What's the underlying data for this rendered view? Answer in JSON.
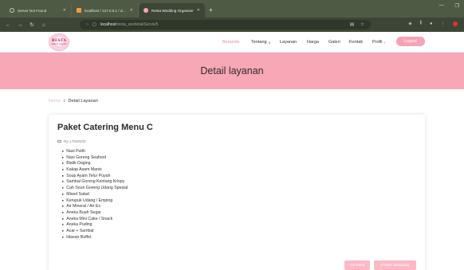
{
  "browser": {
    "tabs": [
      {
        "title": "Server Not Found",
        "active": false
      },
      {
        "title": "localhost / 127.0.0.1 / db_wo / ...",
        "active": false
      },
      {
        "title": "Resta Wedding Organizer",
        "active": true
      }
    ],
    "new_tab": "+",
    "url_host": "localhost",
    "url_path": "/resta_wo/detailServis/5"
  },
  "site": {
    "logo_text": "RESTA",
    "logo_sub": "wedding organizer",
    "nav": [
      "Beranda",
      "Tentang",
      "Layanan",
      "Harga",
      "Galeri",
      "Kontak",
      "Profil"
    ],
    "logout_label": "Logout"
  },
  "banner": {
    "title": "Detail layanan"
  },
  "breadcrumb": {
    "home": "Home",
    "separator": "/",
    "current": "Detail Layanan"
  },
  "package": {
    "title": "Paket Catering Menu C",
    "price": "Rp 17500000",
    "items": [
      "Nasi Putih",
      "Nasi Goreng Seafood",
      "Bistik Daging",
      "Kakap Asam Manis",
      "Soup Ayam Telur Puyuh",
      "Sambal Goreng Kentang Krispy",
      "Cah Soun Goreng Udang Spesial",
      "Mixed Salad",
      "Kerupuk Udang / Emping",
      "Air Mineral / Air Es",
      "Aneka Buah Segar",
      "Aneka Mini Cake / Snack",
      "Aneka Puding",
      "Acar + Sambal",
      "Hiasan Buffet"
    ]
  },
  "actions": {
    "back_label": "Go Back",
    "order_label": "Pesan Sekarang"
  },
  "colors": {
    "accent": "#f8a7b6",
    "button": "#fbb9c6",
    "browser_dark": "#3d4636"
  }
}
